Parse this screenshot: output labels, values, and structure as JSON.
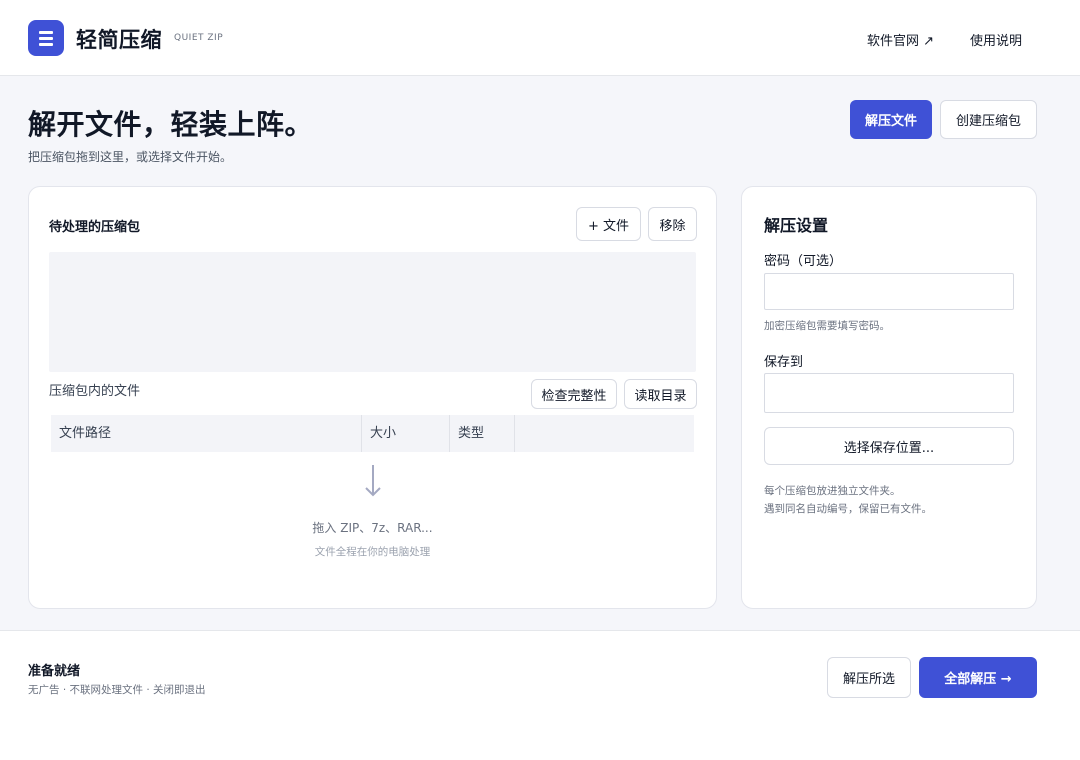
{
  "header": {
    "app_name": "轻简压缩",
    "app_sub": "QUIET ZIP",
    "nav": {
      "website": "软件官网 ↗",
      "guide": "使用说明"
    }
  },
  "hero": {
    "title": "解开文件，轻装上阵。",
    "subtitle": "把压缩包拖到这里，或选择文件开始。",
    "extract_button": "解压文件",
    "create_button": "创建压缩包"
  },
  "archives": {
    "title": "待处理的压缩包",
    "add_button": "+  文件",
    "remove_button": "移除",
    "contents_label": "压缩包内的文件",
    "check_button": "检查完整性",
    "read_button": "读取目录",
    "columns": [
      "文件路径",
      "大小",
      "类型"
    ],
    "empty_main": "拖入 ZIP、7z、RAR...",
    "empty_sub": "文件全程在你的电脑处理"
  },
  "settings": {
    "title": "解压设置",
    "password_label": "密码（可选）",
    "password_value": "",
    "password_hint": "加密压缩包需要填写密码。",
    "save_label": "保存到",
    "save_value": "",
    "choose_button": "选择保存位置...",
    "note_line1": "每个压缩包放进独立文件夹。",
    "note_line2": "遇到同名自动编号，保留已有文件。"
  },
  "footer": {
    "status": "准备就绪",
    "info": "无广告 · 不联网处理文件 · 关闭即退出",
    "extract_selected": "解压所选",
    "extract_all": "全部解压 →"
  },
  "colors": {
    "accent": "#3f51d6",
    "background": "#f5f6fa"
  }
}
